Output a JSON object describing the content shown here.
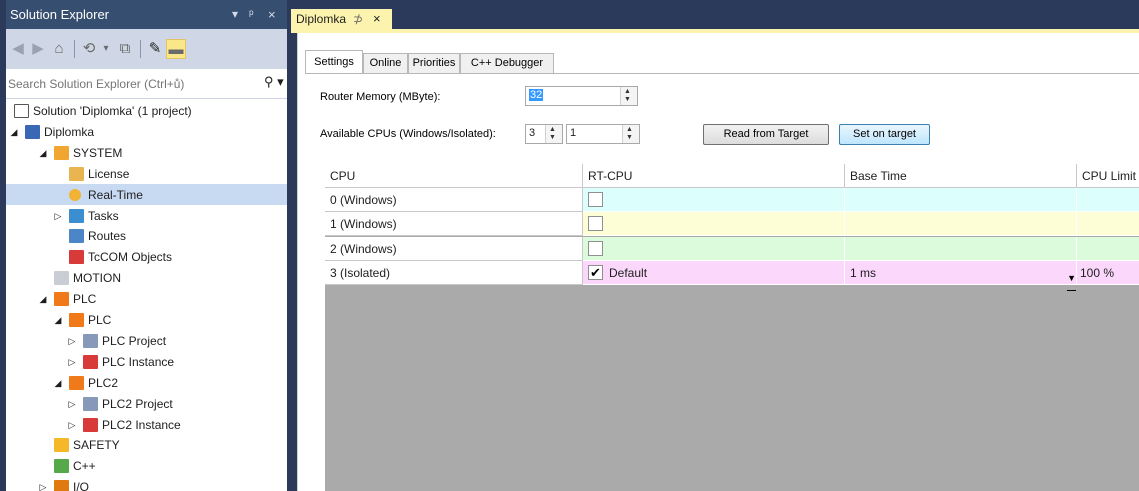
{
  "solution_explorer": {
    "title": "Solution Explorer",
    "title_controls": [
      "▾",
      "ᵖ",
      "×"
    ],
    "toolbar_icons": [
      "back-icon",
      "forward-icon",
      "home-icon",
      "history-icon",
      "sync-icon",
      "properties-icon",
      "preview-icon"
    ],
    "search_placeholder": "Search Solution Explorer (Ctrl+ů)",
    "tree": [
      {
        "label": "Solution 'Diplomka' (1 project)",
        "icon": "solution-icon",
        "level": 0,
        "arrow": ""
      },
      {
        "label": "Diplomka",
        "icon": "project-icon",
        "level": 0,
        "arrow": "◢"
      },
      {
        "label": "SYSTEM",
        "icon": "system-icon",
        "level": 1,
        "arrow": "◢"
      },
      {
        "label": "License",
        "icon": "license-icon",
        "level": 2,
        "arrow": ""
      },
      {
        "label": "Real-Time",
        "icon": "realtime-icon",
        "level": 2,
        "arrow": "",
        "selected": true
      },
      {
        "label": "Tasks",
        "icon": "tasks-icon",
        "level": 2,
        "arrow": "▷"
      },
      {
        "label": "Routes",
        "icon": "routes-icon",
        "level": 2,
        "arrow": ""
      },
      {
        "label": "TcCOM Objects",
        "icon": "tccom-icon",
        "level": 2,
        "arrow": ""
      },
      {
        "label": "MOTION",
        "icon": "motion-icon",
        "level": 1,
        "arrow": ""
      },
      {
        "label": "PLC",
        "icon": "plc-icon",
        "level": 1,
        "arrow": "◢"
      },
      {
        "label": "PLC",
        "icon": "plc-icon",
        "level": 2,
        "arrow": "◢"
      },
      {
        "label": "PLC Project",
        "icon": "plc-project-icon",
        "level": 3,
        "arrow": "▷"
      },
      {
        "label": "PLC Instance",
        "icon": "plc-instance-icon",
        "level": 3,
        "arrow": "▷"
      },
      {
        "label": "PLC2",
        "icon": "plc-icon",
        "level": 2,
        "arrow": "◢"
      },
      {
        "label": "PLC2 Project",
        "icon": "plc-project-icon",
        "level": 3,
        "arrow": "▷"
      },
      {
        "label": "PLC2 Instance",
        "icon": "plc-instance-icon",
        "level": 3,
        "arrow": "▷"
      },
      {
        "label": "SAFETY",
        "icon": "safety-icon",
        "level": 1,
        "arrow": ""
      },
      {
        "label": "C++",
        "icon": "cpp-icon",
        "level": 1,
        "arrow": ""
      },
      {
        "label": "I/O",
        "icon": "io-icon",
        "level": 1,
        "arrow": "▷"
      }
    ]
  },
  "document": {
    "tab_title": "Diplomka",
    "pin_glyph": "⊅",
    "close_glyph": "×",
    "sub_tabs": [
      "Settings",
      "Online",
      "Priorities",
      "C++ Debugger"
    ],
    "active_sub_tab": "Settings",
    "router_memory": {
      "label": "Router Memory (MByte):",
      "value": "32"
    },
    "available_cpus": {
      "label": "Available CPUs (Windows/Isolated):",
      "windows": "3",
      "isolated": "1"
    },
    "buttons": {
      "read": "Read from Target",
      "set": "Set on target"
    },
    "grid": {
      "columns": [
        "CPU",
        "RT-CPU",
        "Base Time",
        "CPU Limit"
      ],
      "rows": [
        {
          "cpu": "0 (Windows)",
          "rt_checked": false,
          "rt_label": "",
          "base_time": "",
          "cpu_limit": "",
          "color": "#dcfffd"
        },
        {
          "cpu": "1 (Windows)",
          "rt_checked": false,
          "rt_label": "",
          "base_time": "",
          "cpu_limit": "",
          "color": "#fdfdd6"
        },
        {
          "cpu": "2 (Windows)",
          "rt_checked": false,
          "rt_label": "",
          "base_time": "",
          "cpu_limit": "",
          "color": "#dcfbdc"
        },
        {
          "cpu": "3 (Isolated)",
          "rt_checked": true,
          "rt_label": "Default",
          "base_time": "1 ms",
          "cpu_limit": "100 %",
          "color": "#fbd7fb"
        }
      ]
    }
  },
  "colors": {
    "explorer_frame": "#2b3a5a",
    "explorer_title": "#364e6f",
    "selection": "#c8daf2",
    "tab_active": "#fcf3ae",
    "grid_background": "#aaaaaa"
  }
}
